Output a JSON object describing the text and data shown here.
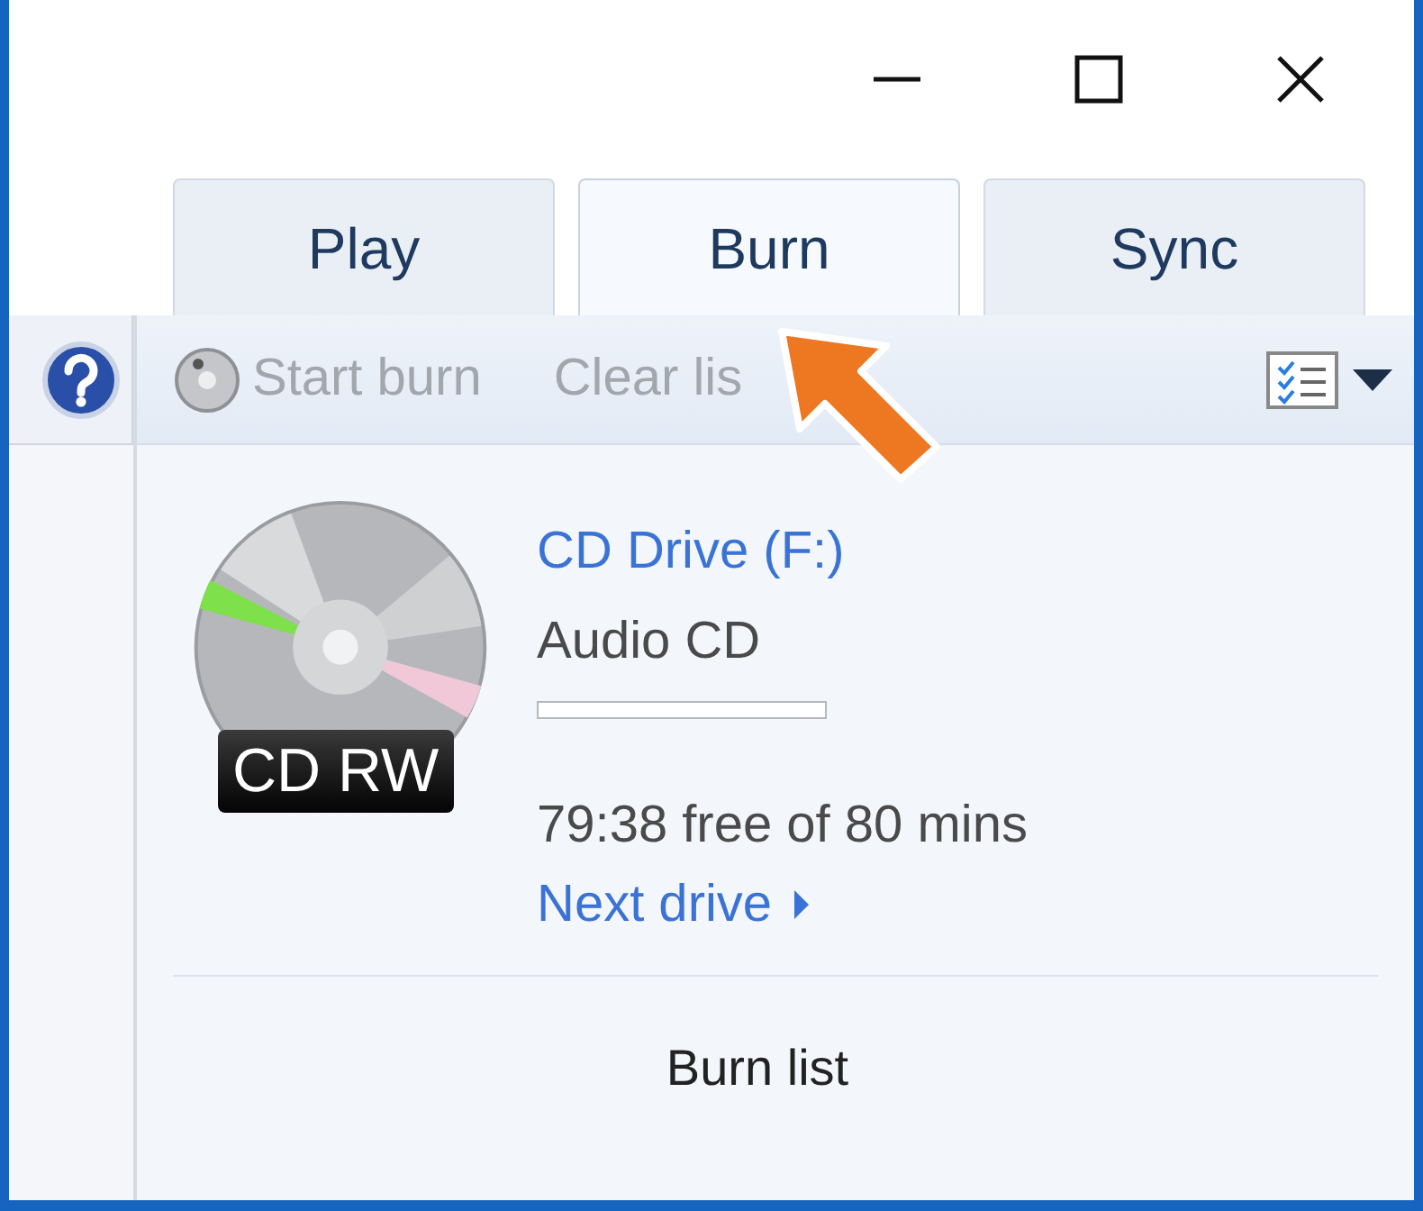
{
  "window": {
    "controls": [
      {
        "kind": "minimize"
      },
      {
        "kind": "maximize"
      },
      {
        "kind": "close"
      }
    ]
  },
  "tabs": [
    {
      "label": "Play",
      "selected": false
    },
    {
      "label": "Burn",
      "selected": true
    },
    {
      "label": "Sync",
      "selected": false
    }
  ],
  "toolbar": {
    "buttons": [
      {
        "label": "Start burn",
        "kind": "burn",
        "disabled": true
      },
      {
        "label": "Clear lis",
        "kind": "plain",
        "disabled": true
      }
    ]
  },
  "drive": {
    "badge": "CD RW",
    "name": "CD Drive (F:)",
    "media": "Audio CD",
    "level": 0,
    "free": "79:38 free of 80 mins",
    "next": "Next drive"
  },
  "list_title": "Burn list"
}
